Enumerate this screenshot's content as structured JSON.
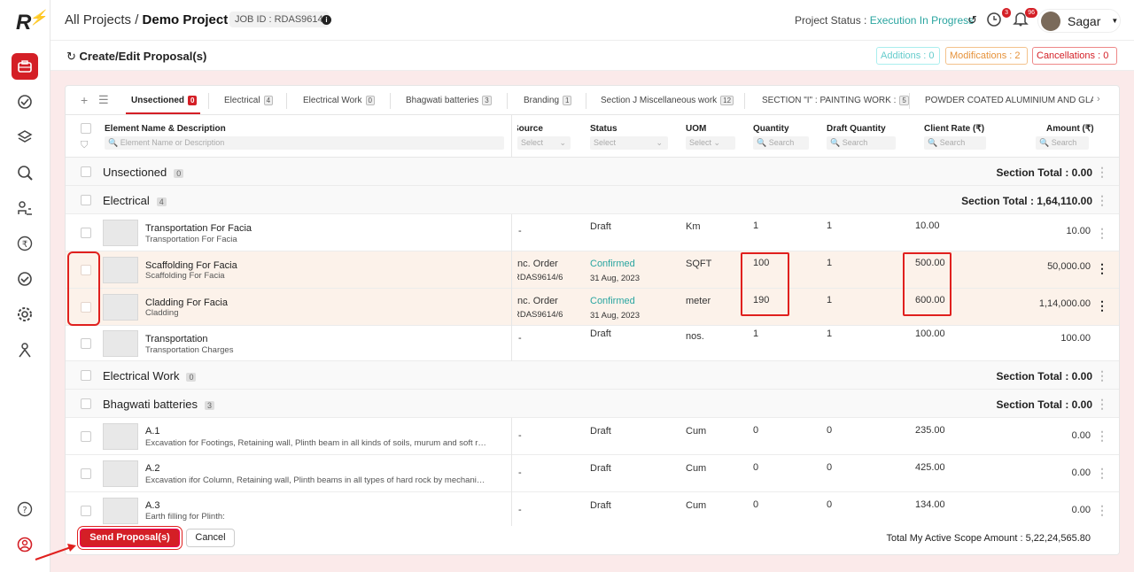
{
  "app": {
    "logo": "R"
  },
  "header": {
    "breadcrumb_root": "All Projects",
    "separator": "/",
    "project": "Demo Project",
    "job_id": "JOB ID : RDAS9614",
    "status_label": "Project Status :",
    "status_value": "Execution In Progress",
    "clock_badge": "3",
    "bell_badge": "96",
    "user": "Sagar"
  },
  "subheader": {
    "title": "Create/Edit Proposal(s)",
    "additions": "Additions : 0",
    "modifications": "Modifications : 2",
    "cancellations": "Cancellations : 0"
  },
  "tabs": [
    {
      "label": "Unsectioned",
      "count": "0"
    },
    {
      "label": "Electrical",
      "count": "4"
    },
    {
      "label": "Electrical Work",
      "count": "0"
    },
    {
      "label": "Bhagwati batteries",
      "count": "3"
    },
    {
      "label": "Branding",
      "count": "1"
    },
    {
      "label": "Section J Miscellaneous work",
      "count": "12"
    },
    {
      "label": "SECTION \"I\" : PAINTING WORK :",
      "count": "5"
    },
    {
      "label": "POWDER COATED ALUMINIUM AND GLA"
    }
  ],
  "columns": {
    "element": "Element Name & Description",
    "element_ph": "Element Name or Description",
    "source": "Source",
    "source_ph": "Select",
    "status": "Status",
    "status_ph": "Select",
    "uom": "UOM",
    "uom_ph": "Select",
    "qty": "Quantity",
    "qty_ph": "Search",
    "draft": "Draft Quantity",
    "draft_ph": "Search",
    "rate": "Client Rate (₹)",
    "rate_ph": "Search",
    "amount": "Amount (₹)",
    "amount_ph": "Search"
  },
  "sections": {
    "unsectioned": {
      "name": "Unsectioned",
      "count": "0",
      "total": "Section Total : 0.00"
    },
    "electrical": {
      "name": "Electrical",
      "count": "4",
      "total": "Section Total : 1,64,110.00"
    },
    "electrical_work": {
      "name": "Electrical Work",
      "count": "0",
      "total": "Section Total : 0.00"
    },
    "bhagwati": {
      "name": "Bhagwati batteries",
      "count": "3",
      "total": "Section Total : 0.00"
    }
  },
  "items": [
    {
      "name": "Transportation For Facia",
      "desc": "Transportation For Facia",
      "source": "-",
      "status": "Draft",
      "status_date": "",
      "uom": "Km",
      "qty": "1",
      "draft": "1",
      "rate": "10.00",
      "amount": "10.00"
    },
    {
      "name": "Scaffolding For Facia",
      "desc": "Scaffolding For Facia",
      "source": "nc. Order",
      "source2": "RDAS9614/6",
      "status": "Confirmed",
      "status_date": "31 Aug, 2023",
      "uom": "SQFT",
      "qty": "100",
      "draft": "1",
      "rate": "500.00",
      "amount": "50,000.00"
    },
    {
      "name": "Cladding For Facia",
      "desc": "Cladding",
      "source": "nc. Order",
      "source2": "RDAS9614/6",
      "status": "Confirmed",
      "status_date": "31 Aug, 2023",
      "uom": "meter",
      "qty": "190",
      "draft": "1",
      "rate": "600.00",
      "amount": "1,14,000.00"
    },
    {
      "name": "Transportation",
      "desc": "Transportation Charges",
      "source": "-",
      "status": "Draft",
      "status_date": "",
      "uom": "nos.",
      "qty": "1",
      "draft": "1",
      "rate": "100.00",
      "amount": "100.00"
    },
    {
      "name": "A.1",
      "desc": "Excavation for Footings, Retaining wall, Plinth beam in all kinds of soils, murum and soft rock including dressing of sides",
      "source": "-",
      "status": "Draft",
      "uom": "Cum",
      "qty": "0",
      "draft": "0",
      "rate": "235.00",
      "amount": "0.00"
    },
    {
      "name": "A.2",
      "desc": "Excavation ifor Column, Retaining wall, Plinth beams in all types of hard rock by mechanical means including dressing",
      "source": "-",
      "status": "Draft",
      "uom": "Cum",
      "qty": "0",
      "draft": "0",
      "rate": "425.00",
      "amount": "0.00"
    },
    {
      "name": "A.3",
      "desc": "Earth filling for Plinth:",
      "source": "-",
      "status": "Draft",
      "uom": "Cum",
      "qty": "0",
      "draft": "0",
      "rate": "134.00",
      "amount": "0.00"
    }
  ],
  "footer": {
    "send": "Send Proposal(s)",
    "cancel": "Cancel",
    "total": "Total My Active Scope Amount : 5,22,24,565.80"
  },
  "colors": {
    "brand": "#d41f26",
    "confirmed": "#2aa5a0"
  }
}
